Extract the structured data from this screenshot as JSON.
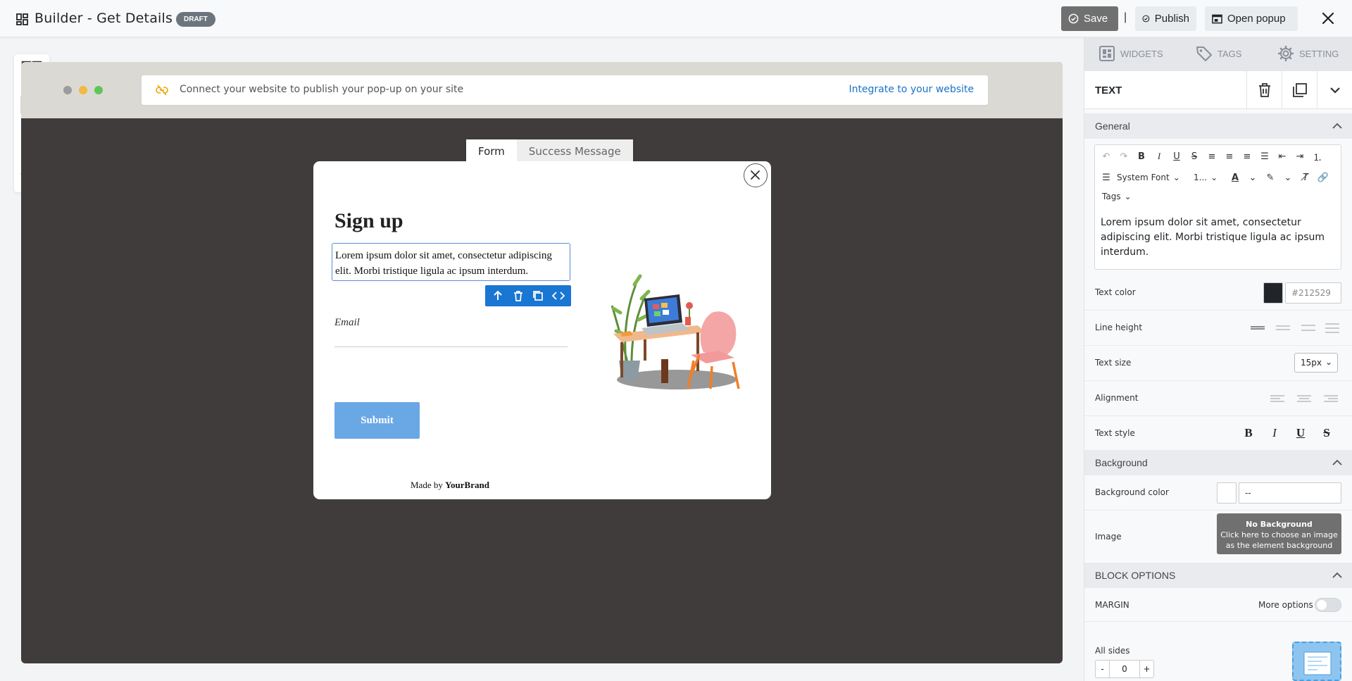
{
  "topbar": {
    "title": "Builder - Get Details",
    "badge": "DRAFT",
    "save_label": "Save",
    "separator": "|",
    "publish_label": "Publish",
    "open_popup_label": "Open popup"
  },
  "notice": {
    "text": "Connect your website to publish your pop-up on your site",
    "link": "Integrate to your website"
  },
  "canvas_tabs": [
    {
      "label": "Form",
      "active": true
    },
    {
      "label": "Success Message",
      "active": false
    }
  ],
  "popup": {
    "heading": "Sign up",
    "body_text": "Lorem ipsum dolor sit amet, consectetur adipiscing elit. Morbi tristique ligula ac ipsum interdum.",
    "email_label": "Email",
    "submit_label": "Submit",
    "made_by_prefix": "Made by",
    "brand": "YourBrand"
  },
  "panel": {
    "tabs": [
      {
        "label": "WIDGETS",
        "icon": "widgets-icon"
      },
      {
        "label": "TAGS",
        "icon": "tag-icon"
      },
      {
        "label": "SETTING",
        "icon": "gear-icon"
      }
    ],
    "element_title": "TEXT",
    "general_section": "General",
    "editor": {
      "font_select": "System Font",
      "size_select": "1...",
      "tags_select": "Tags",
      "content": "Lorem ipsum dolor sit amet, consectetur adipiscing elit. Morbi tristique ligula ac ipsum interdum."
    },
    "text_color_label": "Text color",
    "text_color_value": "#212529",
    "line_height_label": "Line height",
    "text_size_label": "Text size",
    "text_size_value": "15px",
    "alignment_label": "Alignment",
    "text_style_label": "Text style",
    "text_style_buttons": [
      "B",
      "I",
      "U",
      "S"
    ],
    "background_section": "Background",
    "background_color_label": "Background color",
    "background_color_value": "--",
    "image_label": "Image",
    "image_box_title": "No Background",
    "image_box_hint": "Click here to choose an image as the element background",
    "block_options_section": "BLOCK OPTIONS",
    "margin_label": "MARGIN",
    "more_options_label": "More options",
    "all_sides_label": "All sides",
    "stepper_minus": "-",
    "stepper_value": "0",
    "stepper_plus": "+"
  },
  "colors": {
    "accent": "#1976d2",
    "save_bg": "#707070",
    "canvas_bg": "#3f3c3b",
    "submit_bg": "#6aa8e5",
    "link": "#1a73c8"
  }
}
